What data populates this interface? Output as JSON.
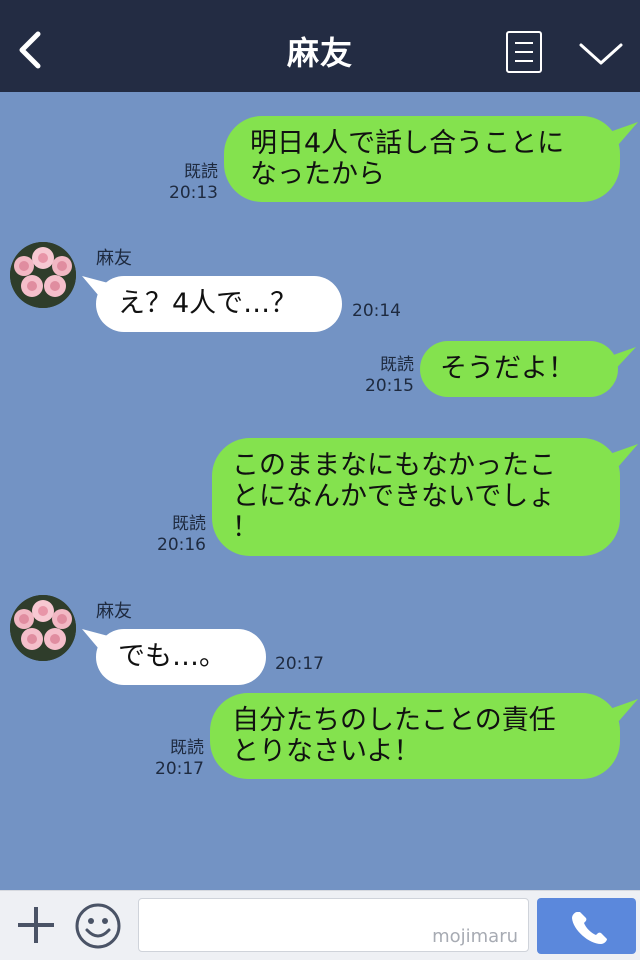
{
  "header": {
    "title": "麻友"
  },
  "messages": [
    {
      "side": "me",
      "lines": [
        "明日4人で話し合うことに",
        "なったから"
      ],
      "read": "既読",
      "time": "20:13"
    },
    {
      "side": "them",
      "sender": "麻友",
      "lines": [
        "え？4人で…？"
      ],
      "time": "20:14"
    },
    {
      "side": "me",
      "lines": [
        "そうだよ！"
      ],
      "read": "既読",
      "time": "20:15"
    },
    {
      "side": "me",
      "lines": [
        "このままなにもなかったこ",
        "とになんかできないでしょ",
        "！"
      ],
      "read": "既読",
      "time": "20:16"
    },
    {
      "side": "them",
      "sender": "麻友",
      "lines": [
        "でも…。"
      ],
      "time": "20:17"
    },
    {
      "side": "me",
      "lines": [
        "自分たちのしたことの責任",
        "とりなさいよ！"
      ],
      "read": "既読",
      "time": "20:17"
    }
  ],
  "input": {
    "placeholder": "",
    "watermark": "mojimaru"
  },
  "colors": {
    "header": "#232c43",
    "chat_bg": "#7393c4",
    "my_bubble": "#84e24e",
    "their_bubble": "#ffffff",
    "call_button": "#5b88dc"
  }
}
